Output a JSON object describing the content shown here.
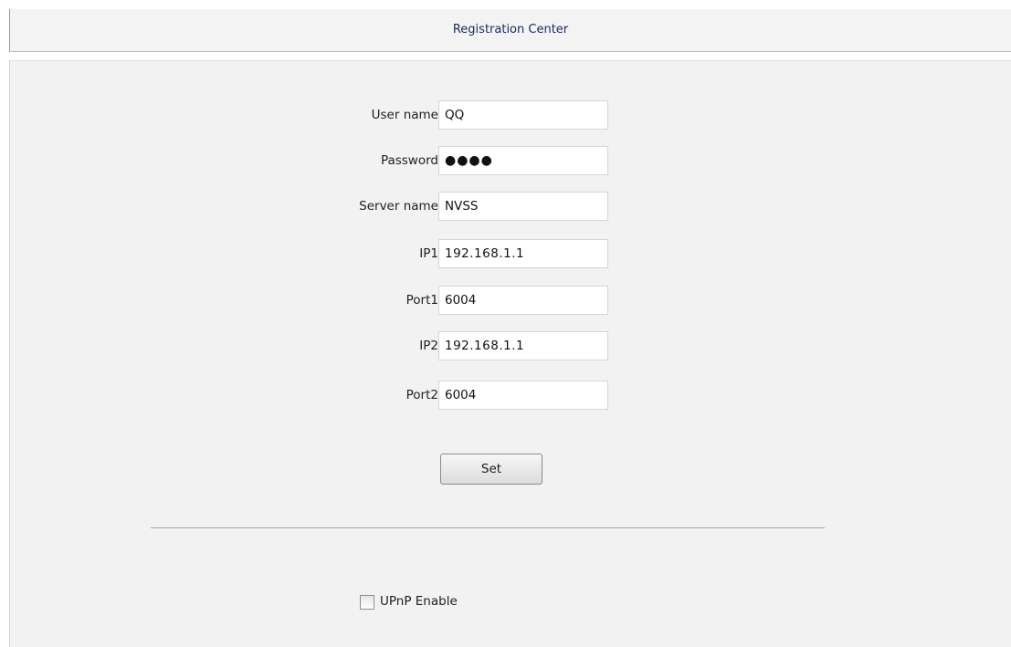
{
  "header": {
    "title": "Registration Center"
  },
  "form": {
    "user_name": {
      "label": "User name",
      "value": "QQ"
    },
    "password": {
      "label": "Password",
      "value": "●●●●"
    },
    "server_name": {
      "label": "Server name",
      "value": "NVSS"
    },
    "ip1": {
      "label": "IP1",
      "value": "192.168.1.1"
    },
    "port1": {
      "label": "Port1",
      "value": "6004"
    },
    "ip2": {
      "label": "IP2",
      "value": "192.168.1.1"
    },
    "port2": {
      "label": "Port2",
      "value": "6004"
    },
    "set_label": "Set"
  },
  "upnp": {
    "label": "UPnP Enable",
    "checked": false
  }
}
